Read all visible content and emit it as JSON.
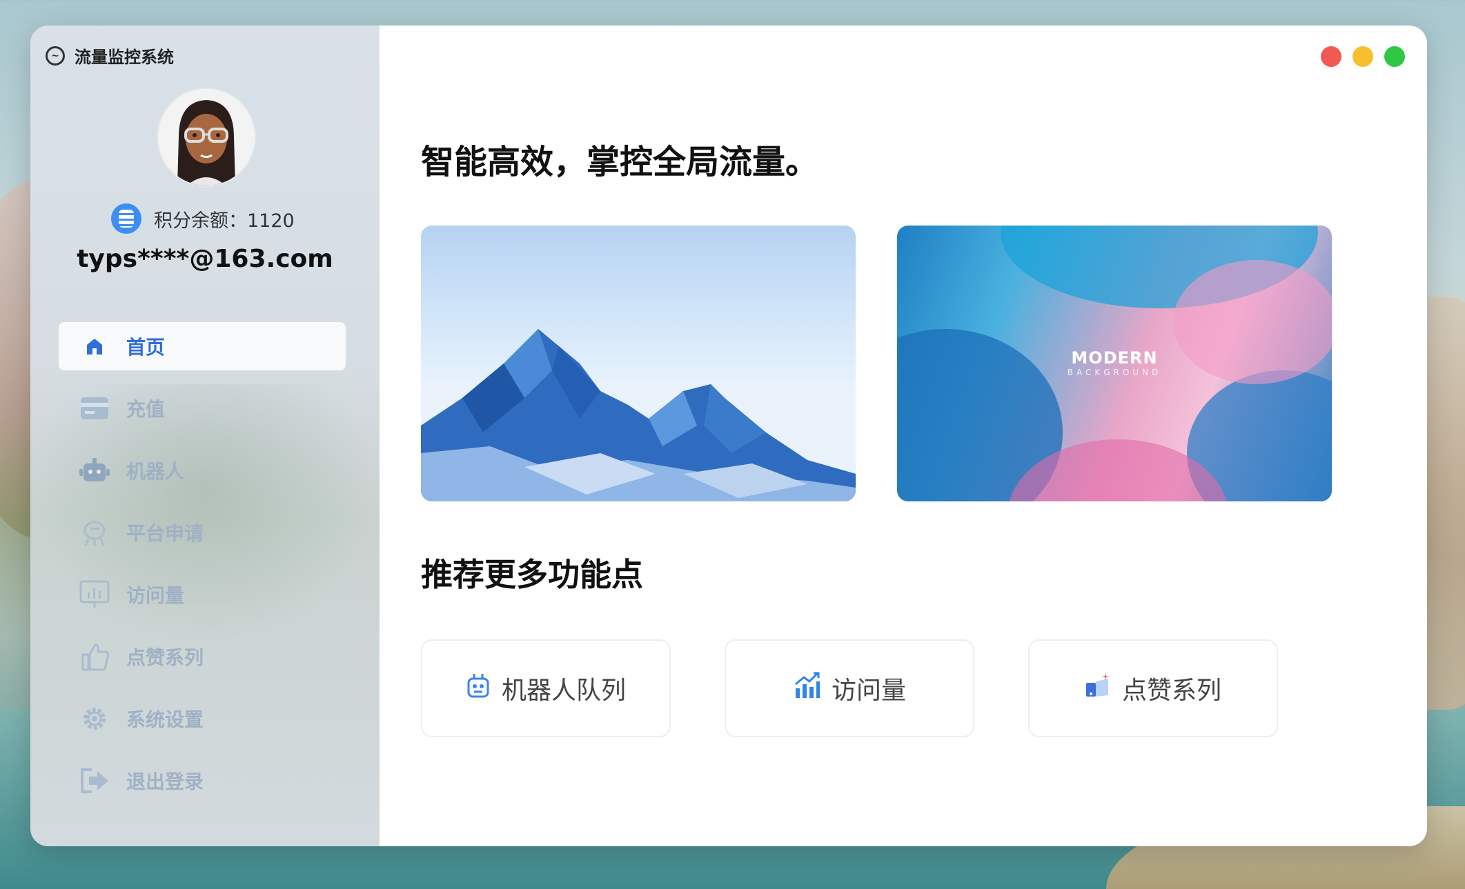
{
  "window": {
    "app_title": "流量监控系统",
    "traffic_lights": {
      "close": "#f05a52",
      "minimize": "#f7be2f",
      "zoom": "#2ec844"
    }
  },
  "sidebar": {
    "credits_label": "积分余额：",
    "credits_value": "1120",
    "email": "typs****@163.com",
    "items": [
      {
        "label": "首页",
        "icon": "home-icon",
        "active": true
      },
      {
        "label": "充值",
        "icon": "card-icon"
      },
      {
        "label": "机器人",
        "icon": "robot-icon"
      },
      {
        "label": "平台申请",
        "icon": "platform-icon"
      },
      {
        "label": "访问量",
        "icon": "monitor-icon"
      },
      {
        "label": "点赞系列",
        "icon": "thumbs-up-icon"
      },
      {
        "label": "系统设置",
        "icon": "gear-icon"
      },
      {
        "label": "退出登录",
        "icon": "logout-icon"
      }
    ]
  },
  "main": {
    "headline": "智能高效，掌控全局流量。",
    "banner_modern": {
      "title": "MODERN",
      "subtitle": "BACKGROUND"
    },
    "section_title": "推荐更多功能点",
    "features": [
      {
        "label": "机器人队列",
        "icon": "robot-icon"
      },
      {
        "label": "访问量",
        "icon": "chart-icon"
      },
      {
        "label": "点赞系列",
        "icon": "like-icon"
      }
    ]
  },
  "colors": {
    "accent": "#2f6fd6",
    "nav_inactive": "#9fb1c6"
  }
}
